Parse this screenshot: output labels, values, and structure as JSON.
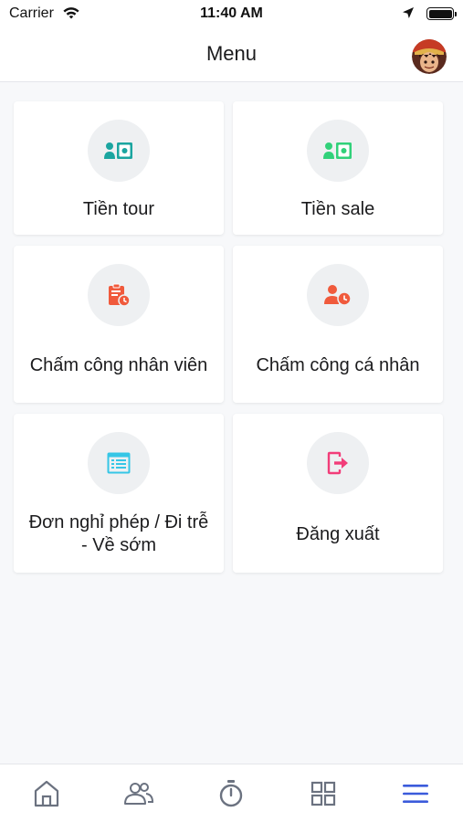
{
  "status_bar": {
    "carrier": "Carrier",
    "time": "11:40 AM"
  },
  "header": {
    "title": "Menu"
  },
  "menu": {
    "items": [
      {
        "label": "Tiền tour",
        "icon": "id-card-money-icon",
        "color": "#1ba5a0"
      },
      {
        "label": "Tiền sale",
        "icon": "id-card-money-icon",
        "color": "#31d17a"
      },
      {
        "label": "Chấm công nhân viên",
        "icon": "clipboard-clock-icon",
        "color": "#f05a3c"
      },
      {
        "label": "Chấm công cá nhân",
        "icon": "user-clock-icon",
        "color": "#f05a3c"
      },
      {
        "label": "Đơn nghỉ phép / Đi trễ - Về sớm",
        "icon": "document-list-icon",
        "color": "#35c6e6"
      },
      {
        "label": "Đăng xuất",
        "icon": "logout-icon",
        "color": "#f23d79"
      }
    ]
  },
  "tab_bar": {
    "items": [
      {
        "icon": "home-icon"
      },
      {
        "icon": "users-icon"
      },
      {
        "icon": "stopwatch-icon"
      },
      {
        "icon": "grid-icon"
      },
      {
        "icon": "menu-icon",
        "active": true
      }
    ],
    "active_color": "#3b5bdb",
    "inactive_color": "#6b7280"
  }
}
